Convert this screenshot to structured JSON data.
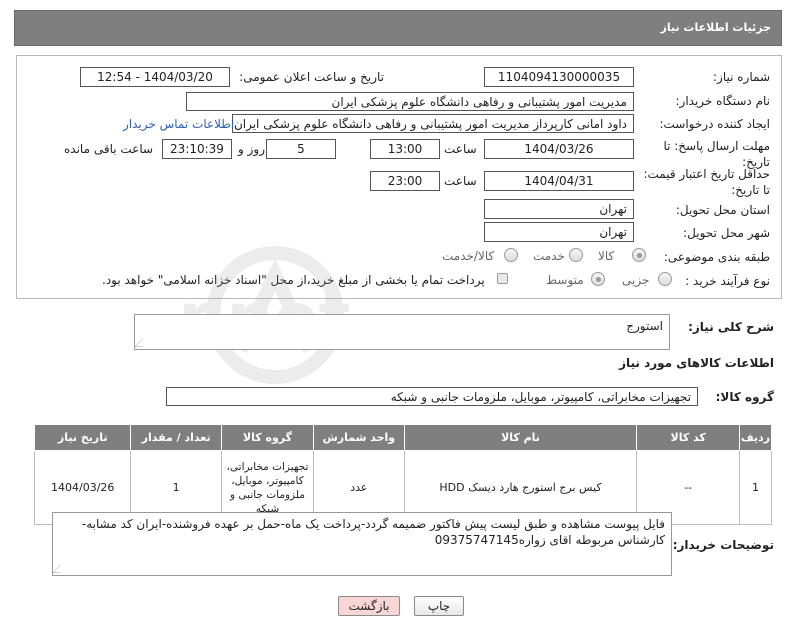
{
  "header": {
    "title": "جزئیات اطلاعات نیاز"
  },
  "fields": {
    "need_number": {
      "label": "شماره نیاز:",
      "value": "1104094130000035"
    },
    "announce_datetime": {
      "label": "تاریخ و ساعت اعلان عمومی:",
      "value": "1404/03/20 - 12:54"
    },
    "buyer_org": {
      "label": "نام دستگاه خریدار:",
      "value": "مدیریت امور پشتیبانی و رفاهی دانشگاه علوم پزشکی ایران"
    },
    "requester": {
      "label": "ایجاد کننده درخواست:",
      "value": "داود امانی کارپرداز مدیریت امور پشتیبانی و رفاهی دانشگاه علوم پزشکی ایران"
    },
    "buyer_contact_link": "اطلاعات تماس خریدار",
    "response_deadline": {
      "label": "مهلت ارسال پاسخ: تا تاریخ:",
      "date": "1404/03/26",
      "time_label": "ساعت",
      "time": "13:00",
      "days": "5",
      "days_label": "روز و",
      "remaining": "23:10:39",
      "remaining_label": "ساعت باقی مانده"
    },
    "price_validity": {
      "label": "حداقل تاریخ اعتبار قیمت: تا تاریخ:",
      "date": "1404/04/31",
      "time_label": "ساعت",
      "time": "23:00"
    },
    "delivery_province": {
      "label": "استان محل تحویل:",
      "value": "تهران"
    },
    "delivery_city": {
      "label": "شهر محل تحویل:",
      "value": "تهران"
    },
    "category": {
      "label": "طبقه بندی موضوعی:",
      "options": [
        "کالا",
        "خدمت",
        "کالا/خدمت"
      ],
      "selected": "کالا"
    },
    "process_type": {
      "label": "نوع فرآیند خرید :",
      "options": [
        "جزیی",
        "متوسط"
      ],
      "selected": "متوسط",
      "payment_note": "پرداخت تمام یا بخشی از مبلغ خرید،از محل \"اسناد خزانه اسلامی\" خواهد بود."
    }
  },
  "summary": {
    "label": "شرح کلی نیاز:",
    "value": "استورج"
  },
  "goods_section": {
    "title": "اطلاعات کالاهای مورد نیاز",
    "group_label": "گروه کالا:",
    "group_value": "تجهیزات مخابراتی، کامپیوتر، موبایل، ملزومات جانبی و شبکه"
  },
  "table": {
    "headers": [
      "ردیف",
      "کد کالا",
      "نام کالا",
      "واحد شمارش",
      "گروه کالا",
      "تعداد / مقدار",
      "تاریخ نیاز"
    ],
    "rows": [
      [
        "1",
        "--",
        "کیس برج استورج هارد دیسک HDD",
        "عدد",
        "تجهیزات مخابراتی، کامپیوتر، موبایل، ملزومات جانبی و شبکه",
        "1",
        "1404/03/26"
      ]
    ]
  },
  "buyer_notes": {
    "label": "توضیحات خریدار:",
    "value": "فایل پیوست مشاهده و طبق لیست پیش فاکتور ضمیمه گردد-پرداخت یک ماه-حمل بر عهده فروشنده-ایران کد مشابه-کارشناس مربوطه اقای زواره09375747145"
  },
  "buttons": {
    "print": "چاپ",
    "back": "بازگشت"
  },
  "watermark": {
    "text": "AriaTender.net"
  },
  "colors": {
    "header_bg": "#7f7f7f",
    "link": "#2e5fb5",
    "back_button_bg": "#f9d6d6"
  }
}
